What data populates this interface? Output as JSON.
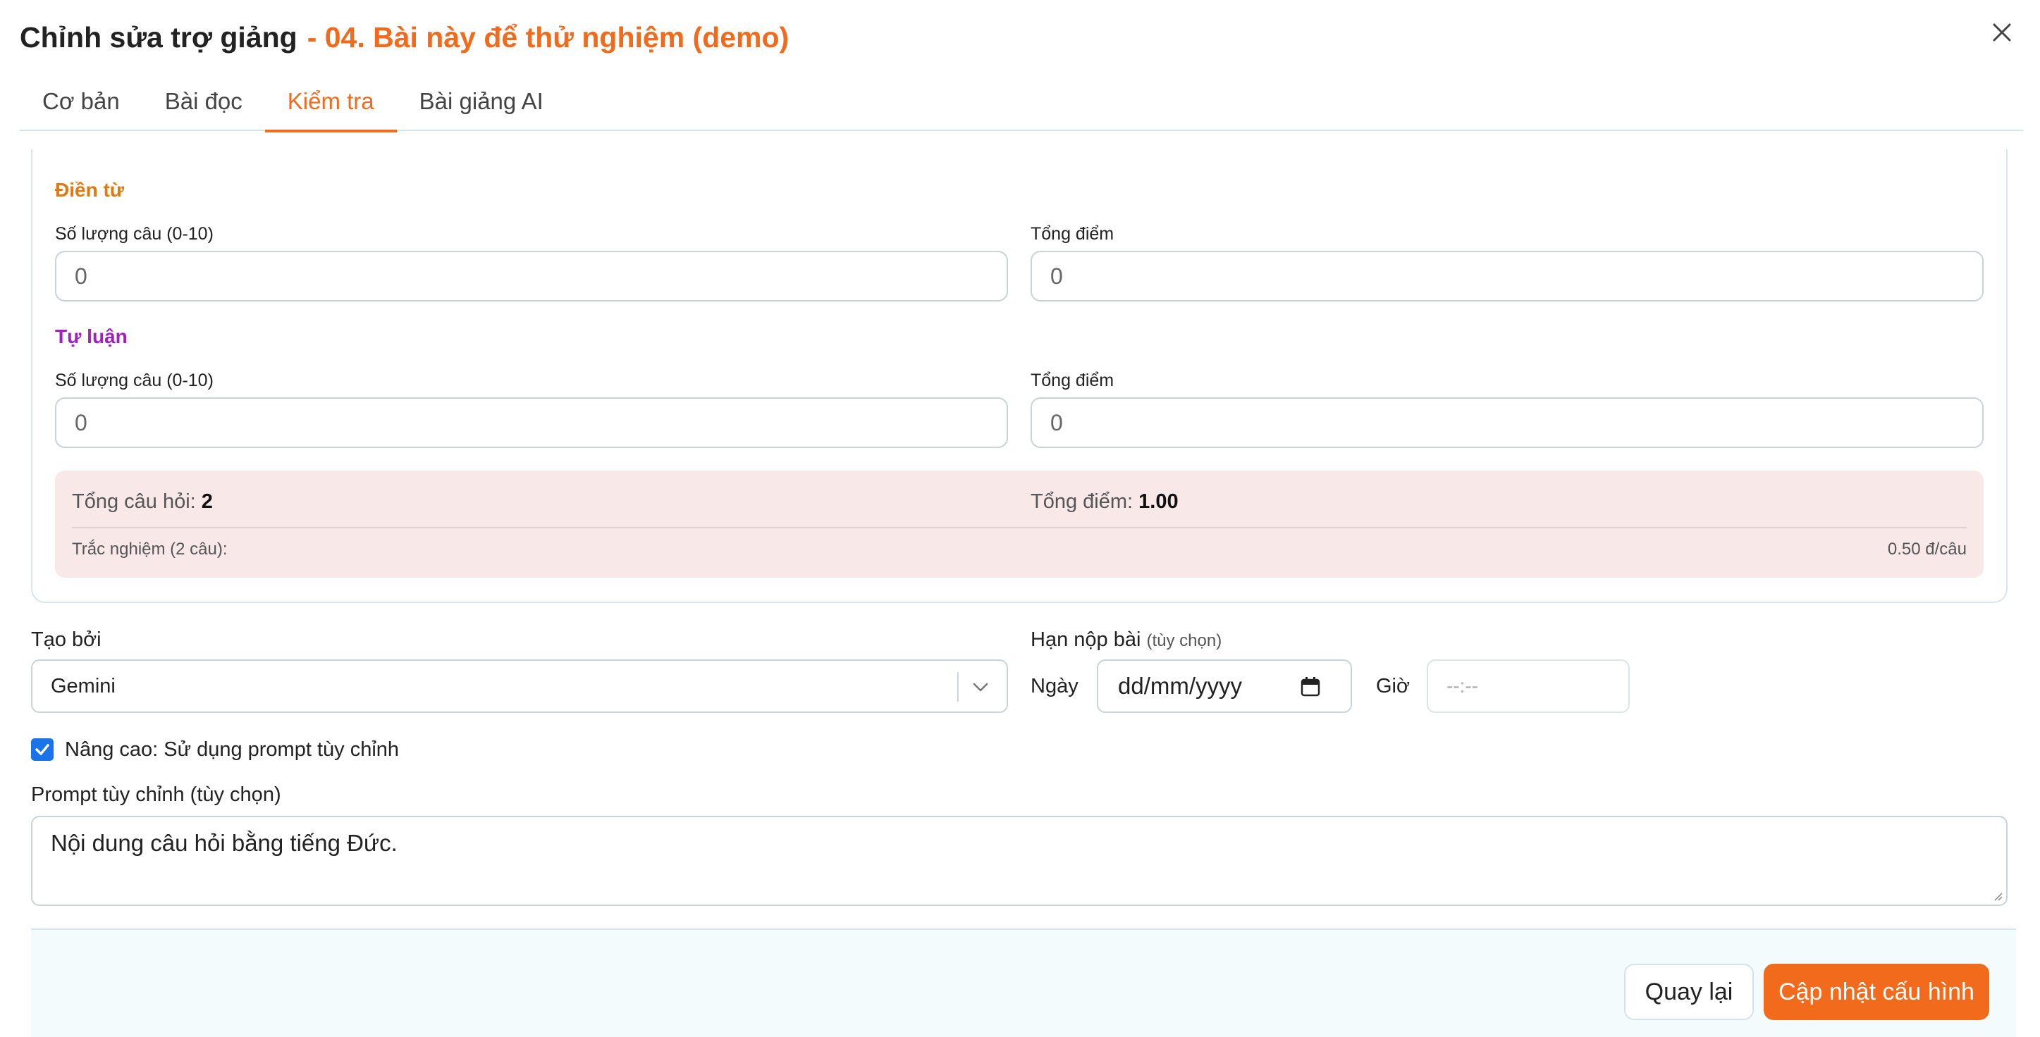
{
  "header": {
    "title": "Chỉnh sửa trợ giảng",
    "subtitle": "- 04. Bài này để thử nghiệm (demo)",
    "close_icon": "close-icon"
  },
  "tabs": [
    {
      "label": "Cơ bản",
      "active": false
    },
    {
      "label": "Bài đọc",
      "active": false
    },
    {
      "label": "Kiểm tra",
      "active": true
    },
    {
      "label": "Bài giảng AI",
      "active": false
    }
  ],
  "sections": {
    "fill_in": {
      "title": "Điền từ",
      "title_color": "#e07a10",
      "count_label": "Số lượng câu (0-10)",
      "count_value": "0",
      "score_label": "Tổng điểm",
      "score_value": "0"
    },
    "essay": {
      "title": "Tự luận",
      "title_color": "#a020c0",
      "count_label": "Số lượng câu (0-10)",
      "count_value": "0",
      "score_label": "Tổng điểm",
      "score_value": "0"
    }
  },
  "summary": {
    "total_questions_label": "Tổng câu hỏi:",
    "total_questions_value": "2",
    "total_score_label": "Tổng điểm:",
    "total_score_value": "1.00",
    "detail_label": "Trắc nghiệm (2 câu):",
    "detail_value": "0.50 đ/câu"
  },
  "form": {
    "created_by_label": "Tạo bởi",
    "created_by_value": "Gemini",
    "deadline_label": "Hạn nộp bài",
    "deadline_optional": "(tùy chọn)",
    "date_label": "Ngày",
    "date_placeholder": "dd/mm/yyyy",
    "time_label": "Giờ",
    "time_placeholder": "--:--",
    "advanced_checkbox_label": "Nâng cao: Sử dụng prompt tùy chỉnh",
    "advanced_checked": true,
    "prompt_label": "Prompt tùy chỉnh (tùy chọn)",
    "prompt_value": "Nội dung câu hỏi bằng tiếng Đức."
  },
  "footer": {
    "back_label": "Quay lại",
    "save_label": "Cập nhật cấu hình"
  },
  "colors": {
    "accent": "#f26b1d",
    "checkbox": "#1a73e8",
    "summary_bg": "#f8e8e8"
  }
}
